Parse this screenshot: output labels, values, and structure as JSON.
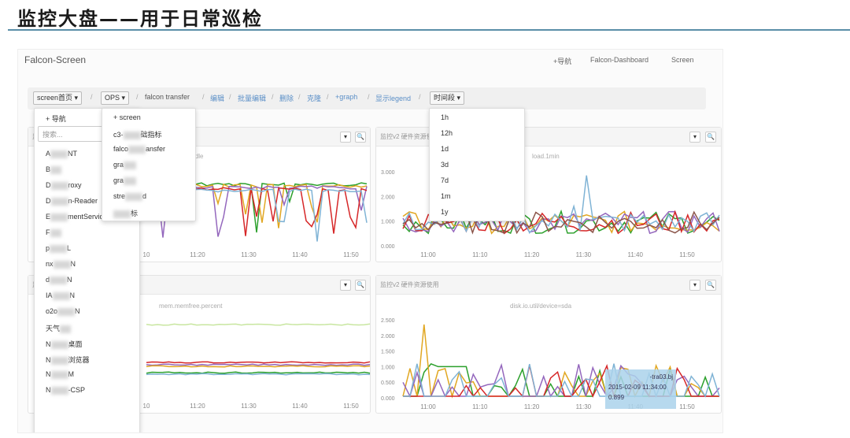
{
  "slide": {
    "title": "监控大盘——用于日常巡检"
  },
  "app": {
    "title": "Falcon-Screen",
    "nav": [
      "+导航",
      "Falcon-Dashboard",
      "Screen"
    ]
  },
  "toolbar": {
    "screen_btn": "screen首页 ▾",
    "ops_btn": "OPS ▾",
    "crumb": "falcon transfer",
    "edit": "编辑",
    "batch_edit": "批量编辑",
    "delete": "删除",
    "clone": "克隆",
    "add_graph": "+graph",
    "show_legend": "显示legend",
    "time_btn": "时间段 ▾",
    "sep": "/"
  },
  "screen_menu": {
    "nav": "+ 导航",
    "search_placeholder": "搜索...",
    "items": [
      "A",
      "NT",
      "B",
      "D",
      "roxy",
      "D",
      "n-Reader",
      "E",
      "mentService",
      "F",
      "p",
      "L",
      "nx",
      "N",
      "d",
      "N",
      "IA",
      "N",
      "o2o",
      "N",
      "天气",
      "N",
      "桌面",
      "N",
      "浏览器",
      "N",
      "M",
      "N",
      "-CSP"
    ]
  },
  "ops_menu": {
    "items": [
      "+ screen",
      "c3-",
      "础指标",
      "falco",
      "ansfer",
      "gra",
      "gra",
      "stre",
      "d",
      "",
      "标"
    ]
  },
  "time_menu": {
    "options": [
      "1h",
      "12h",
      "1d",
      "3d",
      "7d",
      "1m",
      "1y"
    ]
  },
  "panels": {
    "p1": {
      "title": "监",
      "metric": "idle"
    },
    "p2": {
      "title": "监控v2 硬件资源使用",
      "metric": "load.1min"
    },
    "p3": {
      "title": "监",
      "metric": "mem.memfree.percent"
    },
    "p4": {
      "title": "监控v2 硬件资源使用",
      "metric": "disk.io.util/device=sda"
    },
    "ctl_down": "▾",
    "ctl_zoom": "🔍"
  },
  "x_ticks_full": [
    "11:00",
    "11:10",
    "11:20",
    "11:30",
    "11:40",
    "11:50"
  ],
  "x_ticks_left": [
    "10",
    "11:20",
    "11:30",
    "11:40",
    "11:50"
  ],
  "y_ticks_p2": [
    "3.000",
    "2.000",
    "1.000",
    "0.000"
  ],
  "y_ticks_p4": [
    "2.500",
    "2.000",
    "1.500",
    "1.000",
    "0.500",
    "0.000"
  ],
  "tooltip": {
    "line1": "-tra03.bj",
    "line2": "2015-02-09 11:34:00",
    "line3": "0.899"
  },
  "colors": {
    "series": [
      "#2ca02c",
      "#e1a722",
      "#9467bd",
      "#d62728",
      "#7fb3d5",
      "#8c564b"
    ],
    "link": "#5b8fc7"
  },
  "chart_data": [
    {
      "type": "line",
      "metric": "idle",
      "x": [
        "10",
        "11:20",
        "11:30",
        "11:40",
        "11:50"
      ],
      "note": "dense multi-series, values near top with dips"
    },
    {
      "type": "line",
      "metric": "load.1min",
      "x": [
        "11:00",
        "11:10",
        "11:20",
        "11:30",
        "11:40",
        "11:50"
      ],
      "ylim": [
        0,
        3
      ],
      "y_ticks": [
        "3.000",
        "2.000",
        "1.000",
        "0.000"
      ]
    },
    {
      "type": "line",
      "metric": "mem.memfree.percent",
      "x": [
        "10",
        "11:20",
        "11:30",
        "11:40",
        "11:50"
      ]
    },
    {
      "type": "line",
      "metric": "disk.io.util/device=sda",
      "x": [
        "11:00",
        "11:10",
        "11:20",
        "11:30",
        "11:40",
        "11:50"
      ],
      "ylim": [
        0,
        2.5
      ],
      "y_ticks": [
        "2.500",
        "2.000",
        "1.500",
        "1.000",
        "0.500",
        "0.000"
      ]
    }
  ]
}
